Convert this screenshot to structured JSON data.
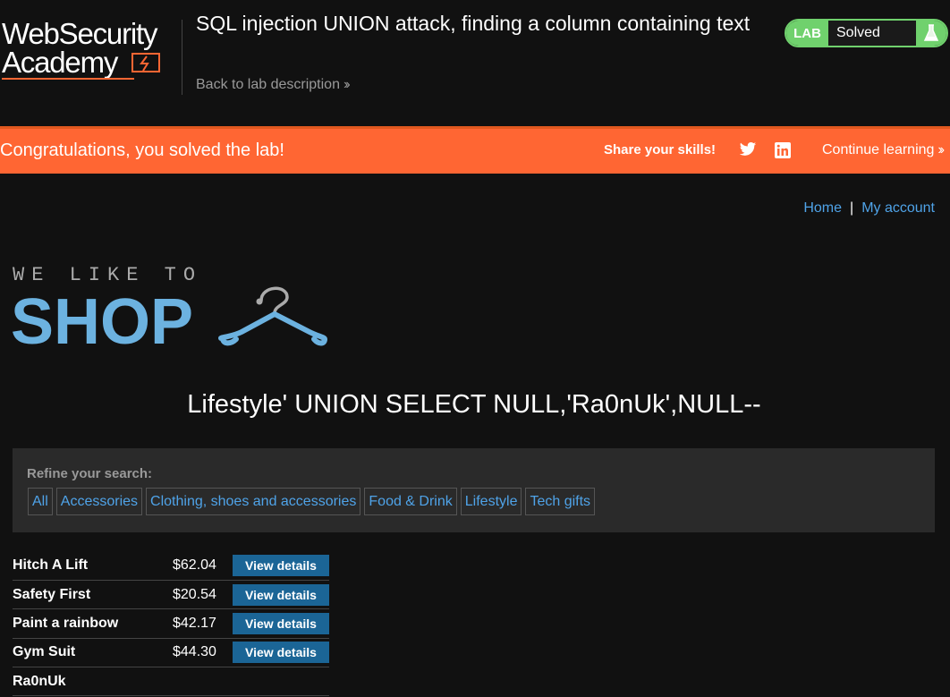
{
  "academy": {
    "logo_line1": "WebSecurity",
    "logo_line2": "Academy",
    "lab_title": "SQL injection UNION attack, finding a column containing text",
    "back_link": "Back to lab description",
    "lab_badge": "LAB",
    "lab_status": "Solved",
    "status_icon": "flask-icon",
    "accent_color": "#ff6633",
    "solved_color": "#70d16d"
  },
  "banner": {
    "message": "Congratulations, you solved the lab!",
    "share_label": "Share your skills!",
    "share_icons": [
      "twitter-icon",
      "linkedin-icon"
    ],
    "continue_label": "Continue learning"
  },
  "nav": {
    "home": "Home",
    "separator": "|",
    "account": "My account"
  },
  "shop_logo": {
    "tagline": "WE LIKE TO",
    "word": "SHOP",
    "icon": "hanger-icon"
  },
  "search": {
    "heading": "Lifestyle' UNION SELECT NULL,'Ra0nUk',NULL--",
    "refine_label": "Refine your search:",
    "filters": [
      "All",
      "Accessories",
      "Clothing, shoes and accessories",
      "Food & Drink",
      "Lifestyle",
      "Tech gifts"
    ]
  },
  "products": [
    {
      "name": "Hitch A Lift",
      "price": "$62.04",
      "action": "View details"
    },
    {
      "name": "Safety First",
      "price": "$20.54",
      "action": "View details"
    },
    {
      "name": "Paint a rainbow",
      "price": "$42.17",
      "action": "View details"
    },
    {
      "name": "Gym Suit",
      "price": "$44.30",
      "action": "View details"
    },
    {
      "name": "Ra0nUk",
      "price": "",
      "action": ""
    }
  ]
}
